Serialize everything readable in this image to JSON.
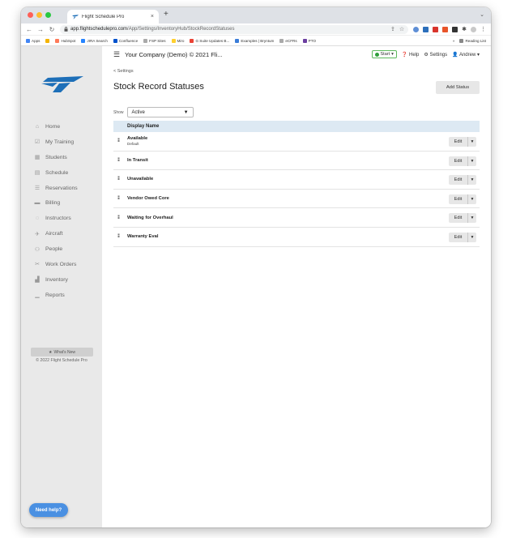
{
  "browser": {
    "tab_title": "Flight Schedule Pro",
    "tab_close": "×",
    "new_tab": "+",
    "url_host": "app.flightschedulepro.com",
    "url_path": "/App/Settings/InventoryHub/StockRecordStatuses",
    "bookmarks": [
      "Apps",
      "HubSpot",
      "JIRA Search",
      "Confluence",
      "FSP Sites",
      "Miro",
      "G Suite Updates B...",
      "Examples | Bryntum",
      "eCFRs",
      "PTO"
    ],
    "reading_list": "Reading List",
    "more": "»"
  },
  "header": {
    "company": "Your Company (Demo) © 2021 Fli...",
    "start": "Start",
    "help": "Help",
    "settings": "Settings",
    "user": "Andrew"
  },
  "sidebar": {
    "items": [
      {
        "label": "Home",
        "icon": "home-icon"
      },
      {
        "label": "My Training",
        "icon": "training-icon"
      },
      {
        "label": "Students",
        "icon": "students-icon"
      },
      {
        "label": "Schedule",
        "icon": "schedule-icon"
      },
      {
        "label": "Reservations",
        "icon": "reservations-icon"
      },
      {
        "label": "Billing",
        "icon": "billing-icon"
      },
      {
        "label": "Instructors",
        "icon": "instructors-icon"
      },
      {
        "label": "Aircraft",
        "icon": "aircraft-icon"
      },
      {
        "label": "People",
        "icon": "people-icon"
      },
      {
        "label": "Work Orders",
        "icon": "work-orders-icon"
      },
      {
        "label": "Inventory",
        "icon": "inventory-icon"
      },
      {
        "label": "Reports",
        "icon": "reports-icon"
      }
    ],
    "whats_new": "What's New",
    "copyright": "© 2022 Flight Schedule Pro",
    "need_help": "Need help?"
  },
  "page": {
    "breadcrumb": "< Settings",
    "title": "Stock Record Statuses",
    "add_button": "Add Status",
    "show_label": "Show",
    "show_value": "Active",
    "column_header": "Display Name",
    "edit_label": "Edit",
    "rows": [
      {
        "name": "Available",
        "sub": "Default"
      },
      {
        "name": "In Transit",
        "sub": ""
      },
      {
        "name": "Unavailable",
        "sub": ""
      },
      {
        "name": "Vendor Owed Core",
        "sub": ""
      },
      {
        "name": "Waiting for Overhaul",
        "sub": ""
      },
      {
        "name": "Warranty Eval",
        "sub": ""
      }
    ]
  },
  "colors": {
    "accent_blue": "#4a90e2",
    "sidebar_bg": "#e9e9e9",
    "table_header_bg": "#dde9f3",
    "start_green": "#2e9e3a",
    "logo_blue": "#1d6fb8"
  }
}
